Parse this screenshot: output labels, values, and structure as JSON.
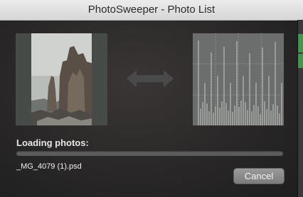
{
  "window": {
    "title": "PhotoSweeper - Photo List"
  },
  "dialog": {
    "loading_label": "Loading photos:",
    "progress": 0.0,
    "current_file": "_MG_4079 (1).psd",
    "cancel_label": "Cancel"
  },
  "icons": {
    "thumbnail": "photo-thumbnail",
    "compare": "double-arrow-icon",
    "histogram": "histogram-icon"
  },
  "colors": {
    "sheet_bg": "#282626",
    "button": "#8a8a8a",
    "accent_green": "#3c9a4a"
  }
}
